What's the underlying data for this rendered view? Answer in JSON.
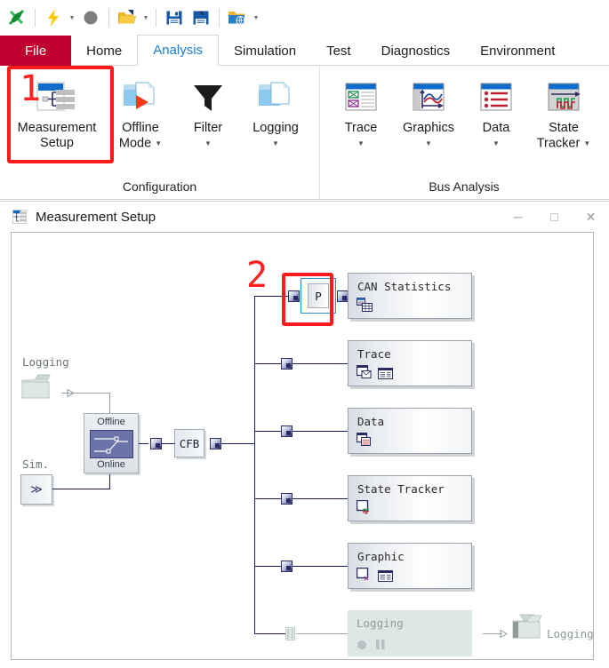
{
  "quick_access": {
    "items": [
      {
        "name": "vector-logo-icon",
        "label": "Vector"
      },
      {
        "name": "flash-icon",
        "label": "Start"
      },
      {
        "name": "flash-dropdown-caret",
        "label": "▾"
      },
      {
        "name": "stop-icon",
        "label": "Stop"
      },
      {
        "name": "open-folder-icon",
        "label": "Open Configuration"
      },
      {
        "name": "open-dropdown-caret",
        "label": "▾"
      },
      {
        "name": "save-icon",
        "label": "Save Configuration"
      },
      {
        "name": "save-as-icon",
        "label": "Save Configuration As"
      },
      {
        "name": "folder-globe-icon",
        "label": "Open Recent"
      },
      {
        "name": "customize-qat-caret",
        "label": "▾"
      }
    ]
  },
  "ribbon": {
    "tabs": [
      {
        "label": "File",
        "state": "file"
      },
      {
        "label": "Home",
        "state": "normal"
      },
      {
        "label": "Analysis",
        "state": "active"
      },
      {
        "label": "Simulation",
        "state": "normal"
      },
      {
        "label": "Test",
        "state": "normal"
      },
      {
        "label": "Diagnostics",
        "state": "normal"
      },
      {
        "label": "Environment",
        "state": "normal"
      }
    ],
    "groups": [
      {
        "title": "Configuration",
        "buttons": [
          {
            "label": "Measurement",
            "label2": "Setup",
            "dropdown": false,
            "icon": "measurement-setup-icon"
          },
          {
            "label": "Offline",
            "label2": "Mode",
            "dropdown": true,
            "icon": "offline-mode-icon"
          },
          {
            "label": "Filter",
            "label2": "",
            "dropdown": true,
            "icon": "filter-icon"
          },
          {
            "label": "Logging",
            "label2": "",
            "dropdown": true,
            "icon": "logging-icon"
          }
        ]
      },
      {
        "title": "Bus Analysis",
        "buttons": [
          {
            "label": "Trace",
            "label2": "",
            "dropdown": true,
            "icon": "trace-icon"
          },
          {
            "label": "Graphics",
            "label2": "",
            "dropdown": true,
            "icon": "graphics-icon"
          },
          {
            "label": "Data",
            "label2": "",
            "dropdown": true,
            "icon": "data-icon"
          },
          {
            "label": "State",
            "label2": "Tracker",
            "dropdown": true,
            "icon": "state-tracker-icon"
          }
        ]
      }
    ]
  },
  "annotations": [
    {
      "number": "1",
      "target": "measurement-setup-button"
    },
    {
      "number": "2",
      "target": "p-node"
    }
  ],
  "window": {
    "title": "Measurement Setup",
    "icon": "measurement-setup-icon",
    "controls": [
      {
        "name": "minimize-button",
        "glyph": "─"
      },
      {
        "name": "maximize-button",
        "glyph": "□"
      },
      {
        "name": "close-button",
        "glyph": "✕"
      }
    ]
  },
  "diagram": {
    "left": {
      "logging_label": "Logging",
      "sim_label": "Sim.",
      "sim_button": "≫",
      "switch": {
        "top": "Offline",
        "bottom": "Online"
      },
      "cfb_label": "CFB"
    },
    "p_node": {
      "label": "P"
    },
    "blocks": [
      {
        "caption": "CAN Statistics",
        "icons": [
          "statistics-table-icon"
        ],
        "disabled": false
      },
      {
        "caption": "Trace",
        "icons": [
          "trace-window-icon",
          "list-window-icon"
        ],
        "disabled": false
      },
      {
        "caption": "Data",
        "icons": [
          "data-window-icon"
        ],
        "disabled": false
      },
      {
        "caption": "State Tracker",
        "icons": [
          "state-tracker-window-icon"
        ],
        "disabled": false
      },
      {
        "caption": "Graphic",
        "icons": [
          "graphic-window-icon",
          "list-window-icon"
        ],
        "disabled": false
      },
      {
        "caption": "Logging",
        "icons": [
          "record-dot-icon",
          "pause-icon"
        ],
        "disabled": true
      }
    ],
    "output_logging_label": "Logging"
  },
  "colors": {
    "file_tab": "#c00030",
    "active_tab_text": "#1b7fd4",
    "highlight": "#ff1a1a",
    "wire": "#1a1a6e",
    "block_border": "#9aa2ad"
  }
}
